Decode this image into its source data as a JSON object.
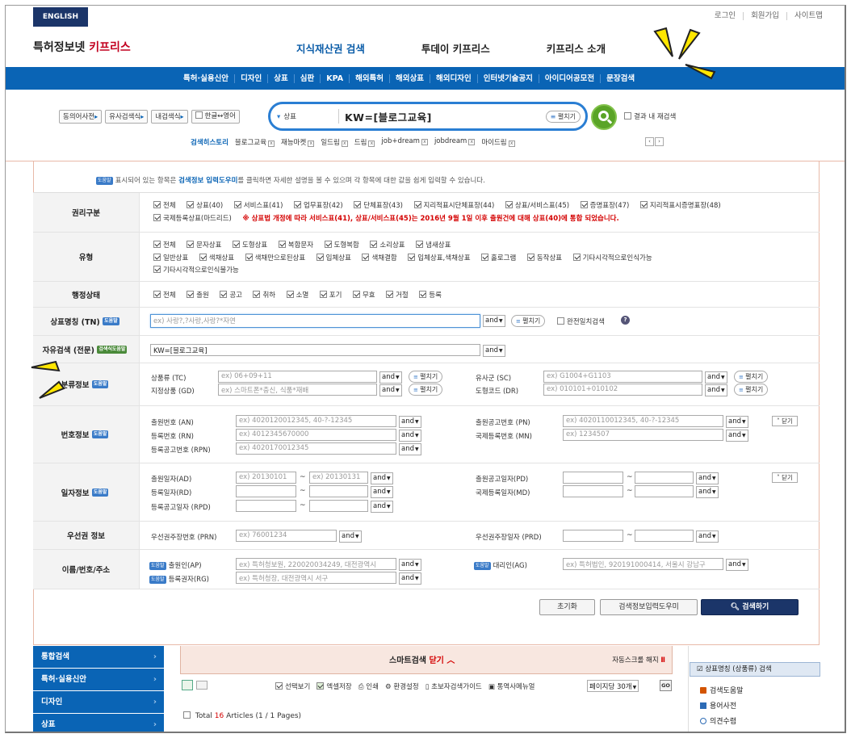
{
  "header": {
    "english": "ENGLISH",
    "top_links": [
      "로그인",
      "회원가입",
      "사이트맵"
    ],
    "logo_black": "특허정보넷 ",
    "logo_red": "키프리스",
    "main_nav": [
      "지식재산권 검색",
      "투데이 키프리스",
      "키프리스 소개"
    ],
    "sub_nav": [
      "특허·실용신안",
      "디자인",
      "상표",
      "심판",
      "KPA",
      "해외특허",
      "해외상표",
      "해외디자인",
      "인터넷기술공지",
      "아이디어공모전",
      "문장검색"
    ]
  },
  "search": {
    "side_buttons": [
      "동의어사전",
      "유사검색식",
      "내검색식",
      "한글↔영어"
    ],
    "scope": "상표",
    "query": "KW=[블로그교육]",
    "expand_label": "펼치기",
    "recheck_label": "결과 내 재검색",
    "history_title": "검색히스토리",
    "history": [
      "블로그교육",
      "재능마켓",
      "일드림",
      "드림",
      "job+dream",
      "jobdream",
      "마이드림"
    ]
  },
  "form": {
    "notice_pre": "표시되어 있는 항목은 ",
    "notice_bold": "검색정보 입력도우미",
    "notice_post": "를 클릭하면 자세한 설명을 볼 수 있으며 각 항목에 대한 값을 쉽게 입력할 수 있습니다.",
    "help_tag": "도움말",
    "help_tag2": "검색식도움말",
    "rights": {
      "label": "권리구분",
      "options": [
        "전체",
        "상표(40)",
        "서비스표(41)",
        "업무표장(42)",
        "단체표장(43)",
        "지리적표시단체표장(44)",
        "상표/서비스표(45)",
        "증명표장(47)",
        "지리적표시증명표장(48)",
        "국제등록상표(마드리드)"
      ],
      "notice": "※ 상표법 개정에 따라 서비스표(41), 상표/서비스표(45)는 2016년 9월 1일 이후 출원건에 대해 상표(40)에 통합 되었습니다."
    },
    "type": {
      "label": "유형",
      "options": [
        "전체",
        "문자상표",
        "도형상표",
        "복합문자",
        "도형복합",
        "소리상표",
        "냄새상표",
        "일반상표",
        "색채상표",
        "색채만으로된상표",
        "입체상표",
        "색채결합",
        "입체상표,색채상표",
        "홀로그램",
        "동작상표",
        "기타시각적으로인식가능",
        "기타시각적으로인식불가능"
      ]
    },
    "status": {
      "label": "행정상태",
      "options": [
        "전체",
        "출원",
        "공고",
        "취하",
        "소멸",
        "포기",
        "무효",
        "거절",
        "등록"
      ]
    },
    "tn": {
      "label": "상표명칭 (TN)",
      "placeholder": "ex) 사랑?,?사랑,사랑?*자연",
      "and": "and",
      "expand": "펼치기",
      "exact": "완전일치검색",
      "q": "?"
    },
    "free": {
      "label": "자유검색 (전문)",
      "value": "KW=[블로그교육]",
      "and": "and"
    },
    "classify": {
      "label": "분류정보",
      "tc_label": "상품류 (TC)",
      "tc_ph": "ex) 06+09+11",
      "gd_label": "지정상품 (GD)",
      "gd_ph": "ex) 스마트폰*충신, 식품*재배",
      "sc_label": "유사군 (SC)",
      "sc_ph": "ex) G1004+G1103",
      "dr_label": "도형코드 (DR)",
      "dr_ph": "ex) 010101+010102",
      "and": "and",
      "expand": "펼치기"
    },
    "number": {
      "label": "번호정보",
      "an_label": "출원번호 (AN)",
      "an_ph": "ex) 4020120012345, 40-?-12345",
      "rn_label": "등록번호 (RN)",
      "rn_ph": "ex) 4012345670000",
      "rpn_label": "등록공고번호 (RPN)",
      "rpn_ph": "ex) 4020170012345",
      "pn_label": "출원공고번호 (PN)",
      "pn_ph": "ex) 4020110012345, 40-?-12345",
      "mn_label": "국제등록번호 (MN)",
      "mn_ph": "ex) 1234507",
      "and": "and",
      "fold": "닫기"
    },
    "date": {
      "label": "일자정보",
      "ad_label": "출원일자(AD)",
      "ad_from": "ex) 20130101",
      "ad_to": "ex) 20130131",
      "rd_label": "등록일자(RD)",
      "rpd_label": "등록공고일자 (RPD)",
      "pd_label": "출원공고일자(PD)",
      "md_label": "국제등록일자(MD)",
      "and": "and",
      "fold": "닫기",
      "tilde": "~"
    },
    "priority": {
      "label": "우선권 정보",
      "prn_label": "우선권주장번호 (PRN)",
      "prn_ph": "ex) 76001234",
      "prd_label": "우선권주장일자 (PRD)",
      "and": "and",
      "tilde": "~"
    },
    "name": {
      "label": "이름/번호/주소",
      "ap_label": "출원인(AP)",
      "ap_ph": "ex) 특허청보원, 220020034249, 대전광역시",
      "rg_label": "등록권자(RG)",
      "rg_ph": "ex) 특허청장, 대전광역시 서구",
      "ag_label": "대리인(AG)",
      "ag_ph": "ex) 특허법인, 920191000414, 서울시 강남구",
      "and": "and"
    },
    "buttons": {
      "reset": "초기화",
      "helper": "검색정보입력도우미",
      "search": "검색하기"
    }
  },
  "left_nav": [
    "통합검색",
    "특허·실용신안",
    "디자인",
    "상표"
  ],
  "smart": {
    "title": "스마트검색 ",
    "title_red": "닫기",
    "arrow": "︿",
    "autoscroll": "자동스크롤 해지",
    "pause": "Ⅱ"
  },
  "tools": {
    "items": [
      "선택보기",
      "엑셀저장",
      "인쇄",
      "환경설정",
      "초보자검색가이드",
      "통역사메뉴얼"
    ],
    "per_page": "페이지당 30개",
    "go": "GO"
  },
  "results": {
    "pre": "Total ",
    "count": "16",
    "post": " Articles (1 / 1 Pages)"
  },
  "right_panel": {
    "tab": "상표명칭 (상품류) 검색",
    "items": [
      "검색도움말",
      "용어사전",
      "의견수렴"
    ]
  },
  "colors": {
    "navy": "#1b3569",
    "blue": "#0a64b5",
    "red": "#c2001f",
    "green": "#5aa427",
    "annotation_yellow": "#ffe600"
  }
}
